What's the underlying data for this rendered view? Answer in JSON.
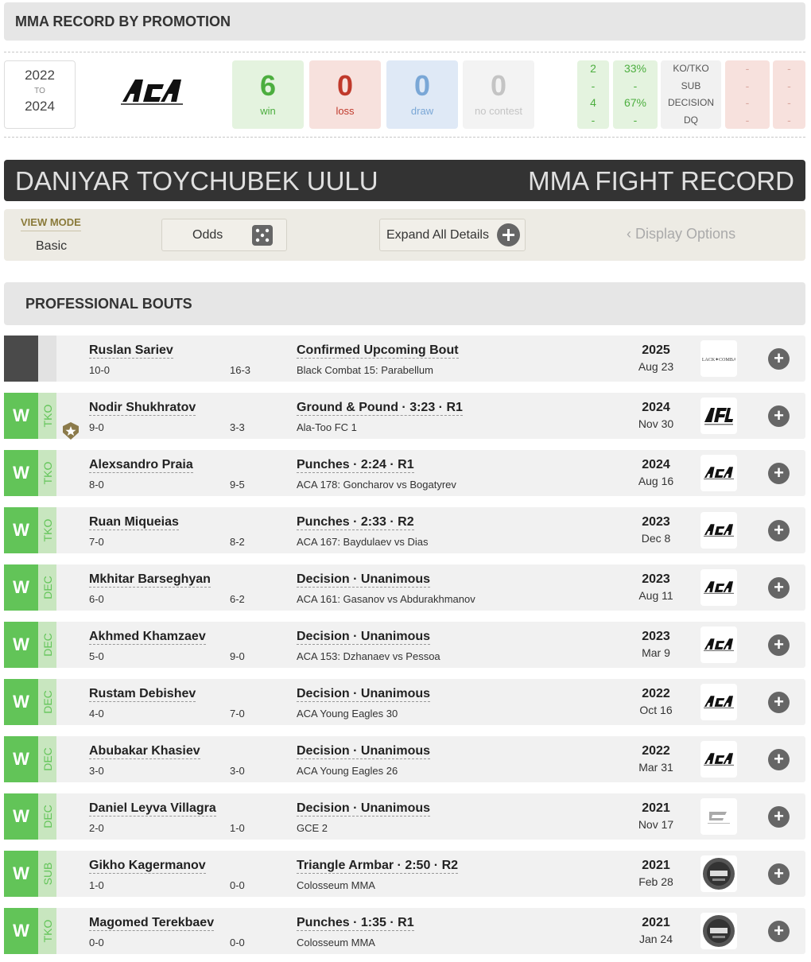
{
  "promotion_record": {
    "title": "MMA RECORD BY PROMOTION",
    "year_from": "2022",
    "year_to_label": "TO",
    "year_to": "2024",
    "logo_text": "ACA",
    "win": {
      "value": "6",
      "label": "win"
    },
    "loss": {
      "value": "0",
      "label": "loss"
    },
    "draw": {
      "value": "0",
      "label": "draw"
    },
    "no_contest": {
      "value": "0",
      "label": "no contest"
    },
    "win_counts": [
      "2",
      "-",
      "4",
      "-"
    ],
    "win_percents": [
      "33%",
      "-",
      "67%",
      "-"
    ],
    "methods": [
      "KO/TKO",
      "SUB",
      "DECISION",
      "DQ"
    ],
    "loss_counts": [
      "-",
      "-",
      "-",
      "-"
    ],
    "loss_percents": [
      "-",
      "-",
      "-",
      "-"
    ]
  },
  "fighter": {
    "name": "DANIYAR TOYCHUBEK UULU",
    "heading": "MMA FIGHT RECORD"
  },
  "view": {
    "mode_label": "VIEW MODE",
    "mode_value": "Basic",
    "odds_label": "Odds",
    "expand_label": "Expand All Details",
    "display_options": "Display Options"
  },
  "section": {
    "title": "PROFESSIONAL BOUTS"
  },
  "bouts": [
    {
      "result": "",
      "method": "",
      "opponent": "Ruslan Sariev",
      "record": "10-0",
      "opp_record": "16-3",
      "finish": "Confirmed Upcoming Bout",
      "event": "Black Combat 15: Parabellum",
      "year": "2025",
      "date": "Aug 23",
      "logo": "BLACK COMBAT"
    },
    {
      "result": "W",
      "method": "TKO",
      "opponent": "Nodir Shukhratov",
      "record": "9-0",
      "opp_record": "3-3",
      "finish": "Ground & Pound · 3:23 · R1",
      "event": "Ala-Too FC 1",
      "year": "2024",
      "date": "Nov 30",
      "logo": "AFL"
    },
    {
      "result": "W",
      "method": "TKO",
      "opponent": "Alexsandro Praia",
      "record": "8-0",
      "opp_record": "9-5",
      "finish": "Punches · 2:24 · R1",
      "event": "ACA 178: Goncharov vs Bogatyrev",
      "year": "2024",
      "date": "Aug 16",
      "logo": "ACA"
    },
    {
      "result": "W",
      "method": "TKO",
      "opponent": "Ruan Miqueias",
      "record": "7-0",
      "opp_record": "8-2",
      "finish": "Punches · 2:33 · R2",
      "event": "ACA 167: Baydulaev vs Dias",
      "year": "2023",
      "date": "Dec 8",
      "logo": "ACA"
    },
    {
      "result": "W",
      "method": "DEC",
      "opponent": "Mkhitar Barseghyan",
      "record": "6-0",
      "opp_record": "6-2",
      "finish": "Decision · Unanimous",
      "event": "ACA 161: Gasanov vs Abdurakhmanov",
      "year": "2023",
      "date": "Aug 11",
      "logo": "ACA"
    },
    {
      "result": "W",
      "method": "DEC",
      "opponent": "Akhmed Khamzaev",
      "record": "5-0",
      "opp_record": "9-0",
      "finish": "Decision · Unanimous",
      "event": "ACA 153: Dzhanaev vs Pessoa",
      "year": "2023",
      "date": "Mar 9",
      "logo": "ACA"
    },
    {
      "result": "W",
      "method": "DEC",
      "opponent": "Rustam Debishev",
      "record": "4-0",
      "opp_record": "7-0",
      "finish": "Decision · Unanimous",
      "event": "ACA Young Eagles 30",
      "year": "2022",
      "date": "Oct 16",
      "logo": "ACA"
    },
    {
      "result": "W",
      "method": "DEC",
      "opponent": "Abubakar Khasiev",
      "record": "3-0",
      "opp_record": "3-0",
      "finish": "Decision · Unanimous",
      "event": "ACA Young Eagles 26",
      "year": "2022",
      "date": "Mar 31",
      "logo": "ACA"
    },
    {
      "result": "W",
      "method": "DEC",
      "opponent": "Daniel Leyva Villagra",
      "record": "2-0",
      "opp_record": "1-0",
      "finish": "Decision · Unanimous",
      "event": "GCE 2",
      "year": "2021",
      "date": "Nov 17",
      "logo": "GCE"
    },
    {
      "result": "W",
      "method": "SUB",
      "opponent": "Gikho Kagermanov",
      "record": "1-0",
      "opp_record": "0-0",
      "finish": "Triangle Armbar · 2:50 · R2",
      "event": "Colosseum MMA",
      "year": "2021",
      "date": "Feb 28",
      "logo": "COLOSSEUM"
    },
    {
      "result": "W",
      "method": "TKO",
      "opponent": "Magomed Terekbaev",
      "record": "0-0",
      "opp_record": "0-0",
      "finish": "Punches · 1:35 · R1",
      "event": "Colosseum MMA",
      "year": "2021",
      "date": "Jan 24",
      "logo": "COLOSSEUM"
    }
  ],
  "colors": {
    "win": "#62c458",
    "win_light": "#c8e6bf",
    "loss": "#c0392b",
    "draw": "#7aa7d6",
    "dark_bar": "#333333"
  }
}
